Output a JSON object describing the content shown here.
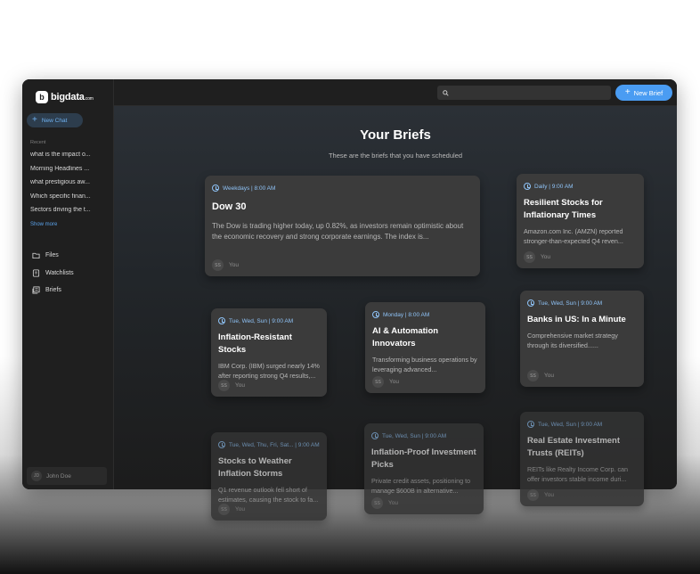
{
  "app": {
    "logo_text": "bigdata",
    "logo_suffix": ".com"
  },
  "sidebar": {
    "new_chat_label": "New Chat",
    "recent_label": "Recent",
    "recent_items": [
      "what is the impact o...",
      "Morning Headlines ...",
      "what prestigious aw...",
      "Which specific finan...",
      "Sectors driving the t..."
    ],
    "show_more_label": "Show more",
    "nav": [
      {
        "label": "Files",
        "icon": "folder-icon"
      },
      {
        "label": "Watchlists",
        "icon": "watchlist-icon"
      },
      {
        "label": "Briefs",
        "icon": "briefs-icon"
      }
    ],
    "user": {
      "initials": "JD",
      "name": "John Doe"
    }
  },
  "topbar": {
    "search_placeholder": "",
    "new_brief_label": "New Brief"
  },
  "main": {
    "title": "Your Briefs",
    "subtitle": "These are the briefs that you have scheduled"
  },
  "briefs": [
    {
      "schedule": "Weekdays | 8:00 AM",
      "title": "Dow 30",
      "body": "The Dow is trading higher today, up 0.82%, as investors remain optimistic about the economic recovery and strong corporate earnings. The index is...",
      "user_initials": "SS",
      "user_name": "You"
    },
    {
      "schedule": "Daily | 9:00 AM",
      "title": "Resilient Stocks for Inflationary Times",
      "body": "Amazon.com Inc. (AMZN) reported stronger-than-expected Q4 reven...",
      "user_initials": "SS",
      "user_name": "You"
    },
    {
      "schedule": "Tue, Wed, Sun | 9:00 AM",
      "title": "Inflation-Resistant Stocks",
      "body": "IBM Corp. (IBM) surged nearly 14% after reporting strong Q4 results,...",
      "user_initials": "SS",
      "user_name": "You"
    },
    {
      "schedule": "Monday | 8:00 AM",
      "title": "AI & Automation Innovators",
      "body": "Transforming business operations by leveraging advanced...",
      "user_initials": "SS",
      "user_name": "You"
    },
    {
      "schedule": "Tue, Wed, Sun | 9:00 AM",
      "title": "Banks in US: In a Minute",
      "body": "Comprehensive market strategy through its diversified......",
      "user_initials": "SS",
      "user_name": "You"
    },
    {
      "schedule": "Tue, Wed, Thu, Fri, Sat... | 9:00 AM",
      "title": "Stocks to Weather Inflation Storms",
      "body": "Q1 revenue outlook fell short of estimates, causing the stock to fa...",
      "user_initials": "SS",
      "user_name": "You"
    },
    {
      "schedule": "Tue, Wed, Sun | 9:00 AM",
      "title": "Inflation-Proof Investment Picks",
      "body": "Private credit assets, positioning to manage $600B in alternative...",
      "user_initials": "SS",
      "user_name": "You"
    },
    {
      "schedule": "Tue, Wed, Sun | 9:00 AM",
      "title": "Real Estate Investment Trusts (REITs)",
      "body": "REITs like Realty Income Corp. can offer investors stable income duri...",
      "user_initials": "SS",
      "user_name": "You"
    }
  ],
  "colors": {
    "accent": "#4a9cf2",
    "schedule_text": "#8fc3f7",
    "card_bg": "#3b3b3b",
    "app_bg": "#1c1c1c"
  }
}
